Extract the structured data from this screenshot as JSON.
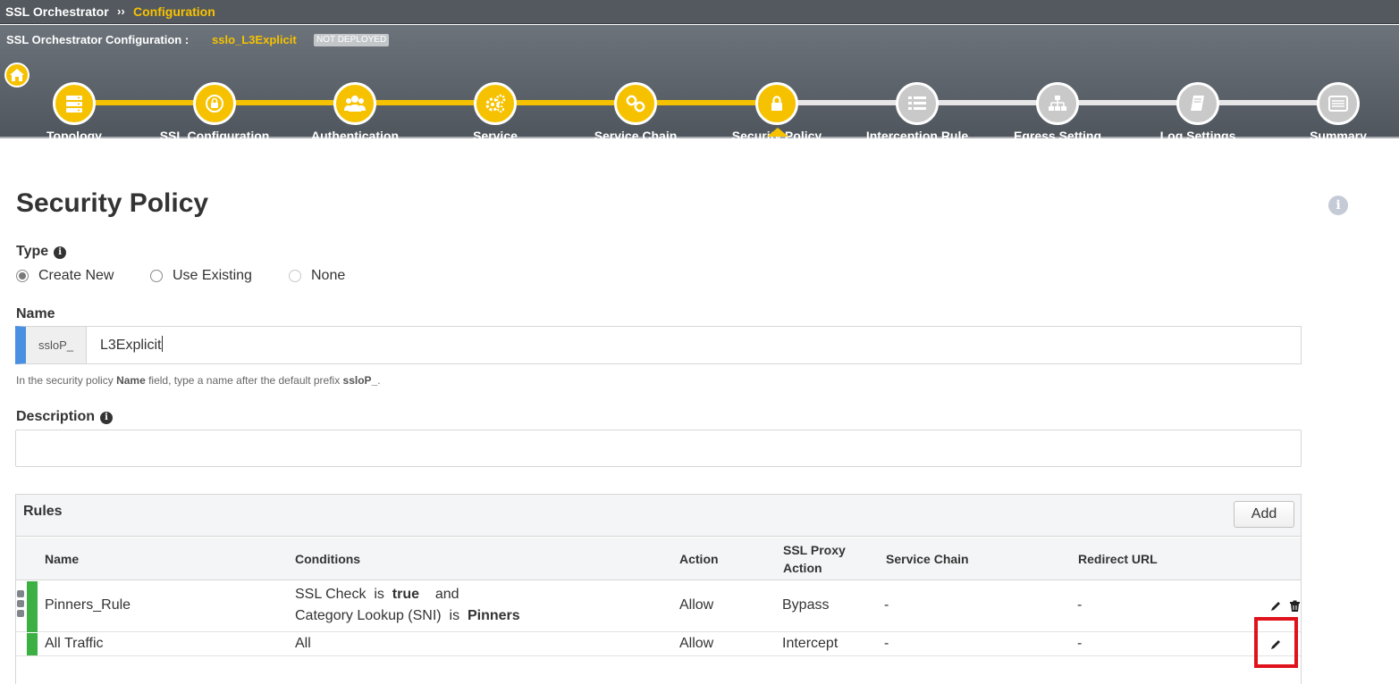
{
  "breadcrumb": {
    "root": "SSL Orchestrator",
    "separator": "››",
    "current": "Configuration"
  },
  "config": {
    "title": "SSL Orchestrator Configuration :",
    "name": "sslo_L3Explicit",
    "status": "NOT DEPLOYED"
  },
  "wizard": {
    "home_icon": "home-icon",
    "steps": [
      {
        "label": "Topology",
        "icon": "server-stack-icon",
        "state": "done"
      },
      {
        "label": "SSL Configuration",
        "icon": "padlock-icon",
        "state": "done"
      },
      {
        "label": "Authentication",
        "icon": "users-icon",
        "state": "done"
      },
      {
        "label": "Service",
        "icon": "gears-icon",
        "state": "done"
      },
      {
        "label": "Service Chain",
        "icon": "chain-link-icon",
        "state": "done"
      },
      {
        "label": "Security Policy",
        "icon": "lock-icon",
        "state": "active"
      },
      {
        "label": "Interception Rule",
        "icon": "list-icon",
        "state": "todo"
      },
      {
        "label": "Egress Setting",
        "icon": "network-tree-icon",
        "state": "todo"
      },
      {
        "label": "Log Settings",
        "icon": "book-icon",
        "state": "todo"
      },
      {
        "label": "Summary",
        "icon": "summary-list-icon",
        "state": "todo"
      }
    ]
  },
  "page": {
    "title": "Security Policy",
    "info_icon": "info-icon"
  },
  "type_field": {
    "label": "Type",
    "options": [
      {
        "label": "Create New",
        "checked": true,
        "enabled": true
      },
      {
        "label": "Use Existing",
        "checked": false,
        "enabled": true
      },
      {
        "label": "None",
        "checked": false,
        "enabled": false
      }
    ]
  },
  "name_field": {
    "label": "Name",
    "prefix": "ssloP_",
    "value": "L3Explicit",
    "hint_pre": "In the security policy ",
    "hint_bold1": "Name",
    "hint_mid": " field, type a name after the default prefix ",
    "hint_bold2": "ssloP_",
    "hint_post": "."
  },
  "description_field": {
    "label": "Description",
    "value": ""
  },
  "rules": {
    "title": "Rules",
    "add_label": "Add",
    "columns": {
      "name": "Name",
      "conditions": "Conditions",
      "action": "Action",
      "ssl_proxy_1": "SSL Proxy",
      "ssl_proxy_2": "Action",
      "service_chain": "Service Chain",
      "redirect_url": "Redirect URL"
    },
    "rows": [
      {
        "name": "Pinners_Rule",
        "cond1_a": "SSL Check",
        "cond1_is": "is",
        "cond1_val": "true",
        "cond1_and": "and",
        "cond2_a": "Category Lookup (SNI)",
        "cond2_is": "is",
        "cond2_val": "Pinners",
        "action": "Allow",
        "ssl_proxy_action": "Bypass",
        "service_chain": "-",
        "redirect_url": "-",
        "status_color": "#3cb043"
      },
      {
        "name": "All Traffic",
        "conditions": "All",
        "action": "Allow",
        "ssl_proxy_action": "Intercept",
        "service_chain": "-",
        "redirect_url": "-",
        "status_color": "#3cb043"
      }
    ]
  },
  "colors": {
    "accent": "#f6c200",
    "header_bg": "#5c636b",
    "highlight": "#e0121b",
    "input_accent": "#4a90e2"
  }
}
